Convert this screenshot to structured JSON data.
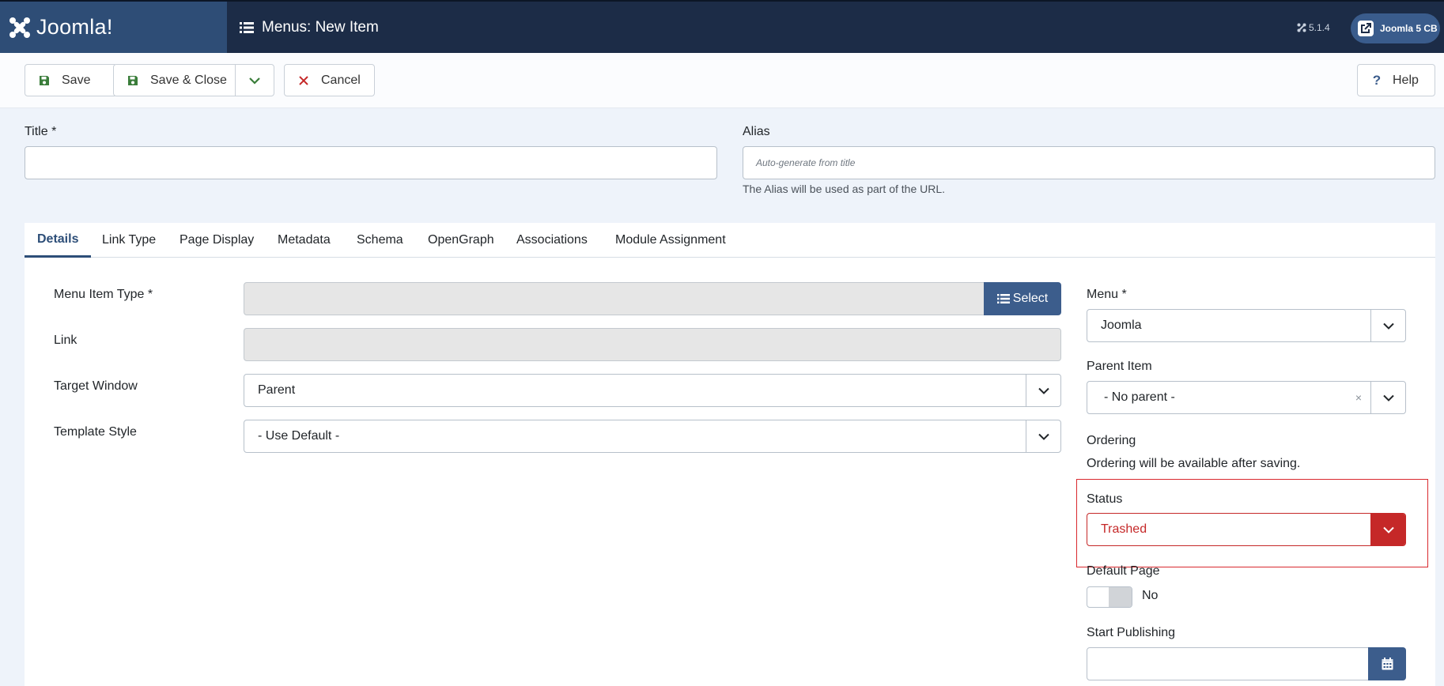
{
  "header": {
    "logo_text": "Joomla!",
    "page_title": "Menus: New Item",
    "version": "5.1.4",
    "site_link": "Joomla 5 CB"
  },
  "toolbar": {
    "save_label": "Save",
    "save_close_label": "Save & Close",
    "cancel_label": "Cancel",
    "help_label": "Help"
  },
  "title_field": {
    "label": "Title *",
    "value": ""
  },
  "alias_field": {
    "label": "Alias",
    "placeholder": "Auto-generate from title",
    "help": "The Alias will be used as part of the URL."
  },
  "tabs": [
    {
      "label": "Details",
      "active": true
    },
    {
      "label": "Link Type"
    },
    {
      "label": "Page Display"
    },
    {
      "label": "Metadata"
    },
    {
      "label": "Schema"
    },
    {
      "label": "OpenGraph"
    },
    {
      "label": "Associations"
    },
    {
      "label": "Module Assignment"
    }
  ],
  "details": {
    "menu_item_type": {
      "label": "Menu Item Type *",
      "value": "",
      "button": "Select"
    },
    "link": {
      "label": "Link",
      "value": ""
    },
    "target_window": {
      "label": "Target Window",
      "value": "Parent"
    },
    "template_style": {
      "label": "Template Style",
      "value": "- Use Default -"
    }
  },
  "sidebar": {
    "menu": {
      "label": "Menu *",
      "value": "Joomla"
    },
    "parent_item": {
      "label": "Parent Item",
      "value": "- No parent -",
      "clear": "×"
    },
    "ordering": {
      "label": "Ordering",
      "note": "Ordering will be available after saving."
    },
    "status": {
      "label": "Status",
      "value": "Trashed"
    },
    "default_page": {
      "label": "Default Page",
      "value": "No"
    },
    "start_publishing": {
      "label": "Start Publishing",
      "value": ""
    }
  },
  "colors": {
    "header_bg": "#1c2c47",
    "logo_bg": "#2e4d76",
    "accent": "#3c5d8c",
    "danger": "#c52828"
  }
}
